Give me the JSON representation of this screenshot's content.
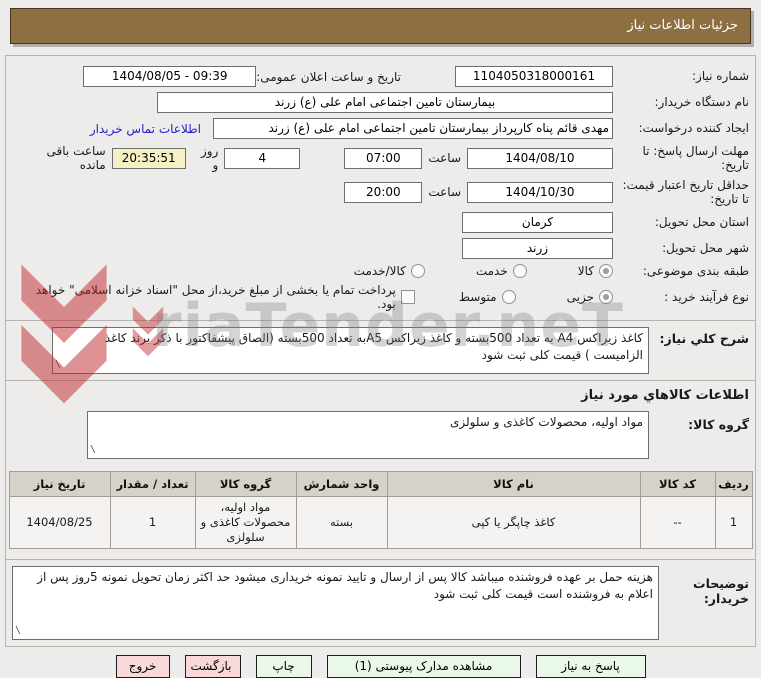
{
  "title_bar": {
    "label": "جزئیات اطلاعات نیاز"
  },
  "form": {
    "need_number": {
      "label": "شماره نیاز:",
      "value": "1104050318000161"
    },
    "announce_datetime": {
      "label": "تاریخ و ساعت اعلان عمومی:",
      "value": "1404/08/05 - 09:39"
    },
    "buyer_org": {
      "label": "نام دستگاه خریدار:",
      "value": "بیمارستان تامین اجتماعی امام علی (ع) زرند"
    },
    "request_creator": {
      "label": "ایجاد کننده درخواست:",
      "value": "مهدی قائم پناه کارپرداز بیمارستان تامین اجتماعی امام علی (ع) زرند",
      "contact_link": "اطلاعات تماس خریدار"
    },
    "reply_deadline": {
      "label": "مهلت ارسال پاسخ: تا تاریخ:",
      "date": "1404/08/10",
      "hour_label": "ساعت",
      "time": "07:00",
      "days_left": "4",
      "days_label": "روز و",
      "countdown": "20:35:51",
      "countdown_label": "ساعت باقی مانده"
    },
    "price_validity": {
      "label": "حداقل تاریخ اعتبار قیمت: تا تاریخ:",
      "date": "1404/10/30",
      "hour_label": "ساعت",
      "time": "20:00"
    },
    "province": {
      "label": "استان محل تحویل:",
      "value": "کرمان"
    },
    "city": {
      "label": "شهر محل تحویل:",
      "value": "زرند"
    },
    "classification": {
      "label": "طبقه بندی موضوعی:",
      "options": [
        {
          "label": "کالا",
          "selected": true
        },
        {
          "label": "خدمت",
          "selected": false
        },
        {
          "label": "کالا/خدمت",
          "selected": false
        }
      ]
    },
    "process_type": {
      "label": "نوع فرآیند خرید :",
      "options": [
        {
          "label": "جزیی",
          "selected": true
        },
        {
          "label": "متوسط",
          "selected": false
        }
      ],
      "treasury_checkbox": {
        "label": "پرداخت تمام یا بخشی از مبلغ خرید،از محل \"اسناد خزانه اسلامی\" خواهد بود.",
        "checked": false
      }
    }
  },
  "need_description": {
    "label": "شرح کلي نياز:",
    "value": "کاغذ زیراکس A4 به تعداد 500بسته و کاغذ زیراکس A5به تعداد 500بسته (الصاق پیشفاکتور با ذکر برند کاغذ الزامیست ) قیمت کلی ثبت شود"
  },
  "goods_section": {
    "header": "اطلاعات کالاهاي مورد نياز",
    "group_label": "گروه کالا:",
    "group_value": "مواد اولیه، محصولات کاغذی و سلولزی"
  },
  "goods_table": {
    "headers": [
      "ردیف",
      "کد کالا",
      "نام کالا",
      "واحد شمارش",
      "گروه کالا",
      "تعداد / مقدار",
      "تاریخ نیاز"
    ],
    "rows": [
      [
        "1",
        "--",
        "کاغذ چاپگر یا کپی",
        "بسته",
        "مواد اولیه، محصولات کاغذی و سلولزی",
        "1",
        "1404/08/25"
      ]
    ]
  },
  "buyer_notes": {
    "label": "توضیحات خریدار:",
    "value": "هزینه حمل بر عهده فروشنده میباشد کالا پس از ارسال و تایید نمونه خریداری میشود حد اکثر زمان تحویل نمونه 5روز پس از اعلام به فروشنده است قیمت کلی ثبت شود"
  },
  "buttons": [
    {
      "label": "پاسخ به نیاز",
      "type": "green"
    },
    {
      "label": "مشاهده مدارک پیوستی (1)",
      "type": "green"
    },
    {
      "label": "چاپ",
      "type": "green"
    },
    {
      "label": "بازگشت",
      "type": "pink"
    },
    {
      "label": "خروج",
      "type": "pink"
    }
  ],
  "watermark": {
    "text": "riaTender.neT"
  },
  "colors": {
    "title_bar_bg": "#8D6F42",
    "countdown_bg": "#F5F1C4",
    "button_green": "#E9F8E9",
    "button_pink": "#F8D8D8",
    "link_blue": "#2222CC",
    "watermark_red": "#C0262C"
  }
}
